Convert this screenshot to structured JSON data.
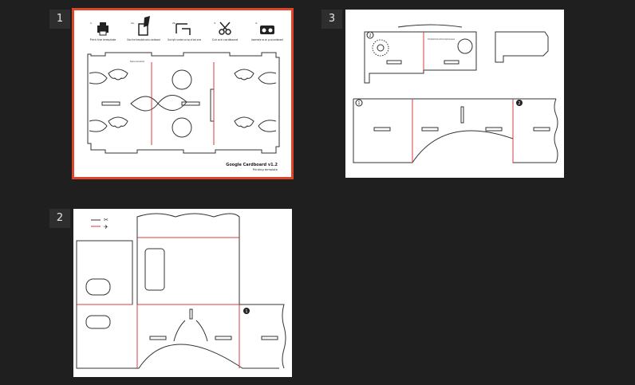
{
  "pages": [
    {
      "number": "1",
      "selected": true
    },
    {
      "number": "2",
      "selected": false
    },
    {
      "number": "3",
      "selected": false
    }
  ],
  "page1": {
    "steps": [
      {
        "num": "1.",
        "label": "Print the template"
      },
      {
        "num": "2a.",
        "label": "Glue the template onto cardboard"
      },
      {
        "num": "2b.",
        "label": "Glue light numbers on top of dark ones"
      },
      {
        "num": "3.",
        "label": "Cut out cardboard"
      },
      {
        "num": "4.",
        "label": "Assemble as on g.co/cardboard"
      }
    ],
    "note": "Please line correct side down",
    "title": "Google Cardboard v1.2",
    "subtitle": "Printing template"
  },
  "page3": {
    "flap_note": "Fold this flap behind the other one after the other magnet to the reverse side",
    "markers": [
      "1",
      "2",
      "2"
    ]
  },
  "colors": {
    "accent": "#e0452a",
    "line": "#333333",
    "fold": "#d93b3b"
  }
}
